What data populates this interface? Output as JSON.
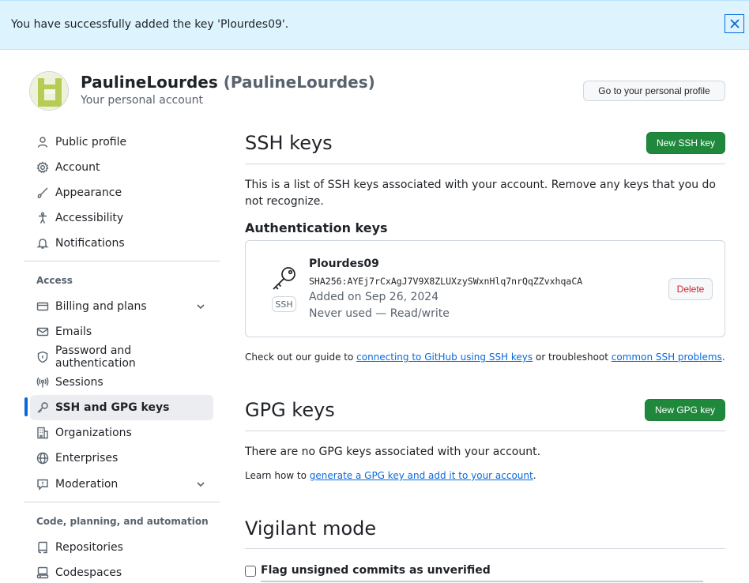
{
  "flash": {
    "message": "You have successfully added the key 'Plourdes09'."
  },
  "header": {
    "display_name": "PaulineLourdes",
    "login": "(PaulineLourdes)",
    "subtitle": "Your personal account",
    "profile_button": "Go to your personal profile"
  },
  "sidebar": {
    "items": [
      {
        "label": "Public profile",
        "icon": "person-icon"
      },
      {
        "label": "Account",
        "icon": "gear-icon"
      },
      {
        "label": "Appearance",
        "icon": "paintbrush-icon"
      },
      {
        "label": "Accessibility",
        "icon": "accessibility-icon"
      },
      {
        "label": "Notifications",
        "icon": "bell-icon"
      }
    ],
    "access_heading": "Access",
    "access_items": [
      {
        "label": "Billing and plans",
        "icon": "credit-card-icon"
      },
      {
        "label": "Emails",
        "icon": "mail-icon"
      },
      {
        "label": "Password and authentication",
        "icon": "shield-lock-icon"
      },
      {
        "label": "Sessions",
        "icon": "broadcast-icon"
      },
      {
        "label": "SSH and GPG keys",
        "icon": "key-icon"
      },
      {
        "label": "Organizations",
        "icon": "organization-icon"
      },
      {
        "label": "Enterprises",
        "icon": "globe-icon"
      },
      {
        "label": "Moderation",
        "icon": "report-icon"
      }
    ],
    "code_heading": "Code, planning, and automation",
    "code_items": [
      {
        "label": "Repositories",
        "icon": "repo-icon"
      },
      {
        "label": "Codespaces",
        "icon": "codespaces-icon"
      }
    ]
  },
  "ssh": {
    "title": "SSH keys",
    "new_button": "New SSH key",
    "description": "This is a list of SSH keys associated with your account. Remove any keys that you do not recognize.",
    "auth_heading": "Authentication keys",
    "key": {
      "title": "Plourdes09",
      "fingerprint": "SHA256:AYEj7rCxAgJ7V9X8ZLUXzySWxnHlq7nrQqZZvxhqaCA",
      "type_badge": "SSH",
      "added": "Added on Sep 26, 2024",
      "usage": "Never used — Read/write",
      "delete_button": "Delete"
    },
    "guide_prefix": "Check out our guide to ",
    "guide_link": "connecting to GitHub using SSH keys",
    "guide_middle": " or troubleshoot ",
    "guide_link2": "common SSH problems",
    "guide_suffix": "."
  },
  "gpg": {
    "title": "GPG keys",
    "new_button": "New GPG key",
    "empty": "There are no GPG keys associated with your account.",
    "learn_prefix": "Learn how to ",
    "learn_link": "generate a GPG key and add it to your account",
    "learn_suffix": "."
  },
  "vigilant": {
    "title": "Vigilant mode",
    "checkbox_label": "Flag unsigned commits as unverified",
    "checked": false
  },
  "colors": {
    "primary": "#1f883d",
    "link": "#0969da",
    "danger": "#d1242f",
    "flash_bg": "#ddf4ff"
  }
}
